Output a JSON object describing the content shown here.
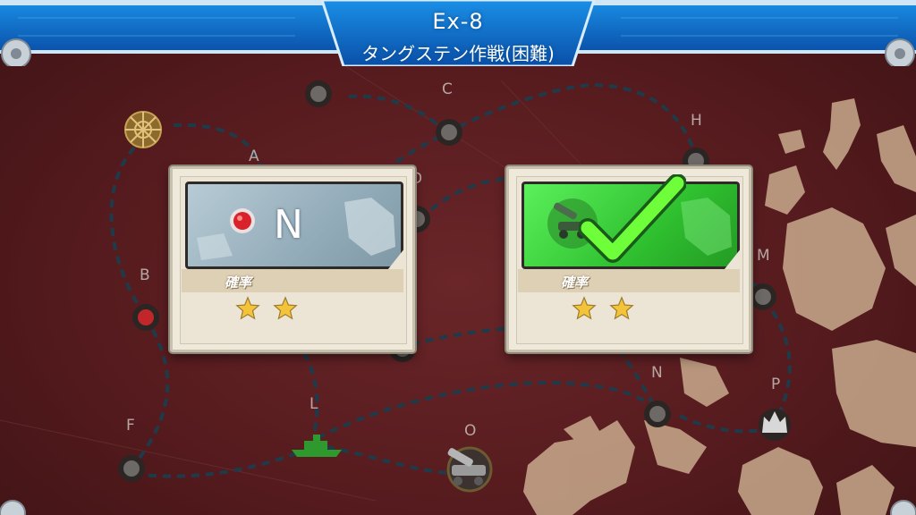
{
  "header": {
    "map_code": "Ex-8",
    "operation_name": "タングステン作戦(困難)"
  },
  "map": {
    "nodes": [
      {
        "id": "A",
        "label": "A"
      },
      {
        "id": "B",
        "label": "B"
      },
      {
        "id": "C",
        "label": "C"
      },
      {
        "id": "D",
        "label": "D"
      },
      {
        "id": "F",
        "label": "F"
      },
      {
        "id": "H",
        "label": "H"
      },
      {
        "id": "L",
        "label": "L"
      },
      {
        "id": "M",
        "label": "M"
      },
      {
        "id": "N",
        "label": "N"
      },
      {
        "id": "O",
        "label": "O"
      },
      {
        "id": "P",
        "label": "P"
      }
    ],
    "colors": {
      "path": "#1f3b4a",
      "node_ring": "#2b2624",
      "node_fill": "#6d6966",
      "red_node": "#c0262a",
      "fleet": "#2e9a2e"
    }
  },
  "cards": {
    "left": {
      "result": "N",
      "rate_label": "確率",
      "stars": 2,
      "panel_color": "#9fb6c2"
    },
    "right": {
      "result": "checkmark",
      "rate_label": "確率",
      "stars": 2,
      "panel_color": "#3fdc3f"
    }
  }
}
